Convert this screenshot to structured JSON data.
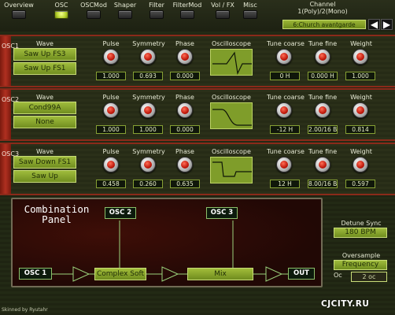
{
  "nav": {
    "tabs": [
      {
        "label": "Overview",
        "active": false
      },
      {
        "label": "OSC",
        "active": true
      },
      {
        "label": "OSCMod",
        "active": false
      },
      {
        "label": "Shaper",
        "active": false
      },
      {
        "label": "Filter",
        "active": false
      },
      {
        "label": "FilterMod",
        "active": false
      },
      {
        "label": "Vol / FX",
        "active": false
      },
      {
        "label": "Misc",
        "active": false
      }
    ],
    "channel_line1": "Channel",
    "channel_line2": "1(Poly)/2(Mono)",
    "preset": "6:Church avantgarde",
    "prev_icon": "◀",
    "next_icon": "▶"
  },
  "labels": {
    "wave": "Wave",
    "pulse": "Pulse",
    "symmetry": "Symmetry",
    "phase": "Phase",
    "oscilloscope": "Oscilloscope",
    "tune_coarse": "Tune coarse",
    "tune_fine": "Tune fine",
    "weight": "Weight"
  },
  "oscs": [
    {
      "side": "OSC1",
      "wave1": "Saw Up FS3",
      "wave2": "Saw Up FS1",
      "pulse": "1.000",
      "symmetry": "0.693",
      "phase": "0.000",
      "tune_coarse": "0 H",
      "tune_fine": "0.000 H",
      "weight": "1.000"
    },
    {
      "side": "OSC2",
      "wave1": "Cond99A",
      "wave2": "None",
      "pulse": "1.000",
      "symmetry": "1.000",
      "phase": "0.000",
      "tune_coarse": "-12 H",
      "tune_fine": "2.00/16 B",
      "weight": "0.814"
    },
    {
      "side": "OSC3",
      "wave1": "Saw Down FS1",
      "wave2": "Saw Up",
      "pulse": "0.458",
      "symmetry": "0.260",
      "phase": "0.635",
      "tune_coarse": "12 H",
      "tune_fine": "8.00/16 B",
      "weight": "0.597"
    }
  ],
  "combination": {
    "title_line1": "Combination",
    "title_line2": "Panel",
    "osc1": "OSC 1",
    "osc2": "OSC 2",
    "osc3": "OSC 3",
    "slot1": "Complex Soft",
    "slot2": "Mix",
    "out": "OUT"
  },
  "right": {
    "detune_label": "Detune Sync",
    "detune_value": "180 BPM",
    "oversample_label": "Oversample",
    "oversample_value": "Frequency",
    "oversample_sub": "Oc",
    "oversample_sub2": "2 oc"
  },
  "skin_credit": "Skinned by Ryutahr",
  "watermark": "CJCITY.RU"
}
